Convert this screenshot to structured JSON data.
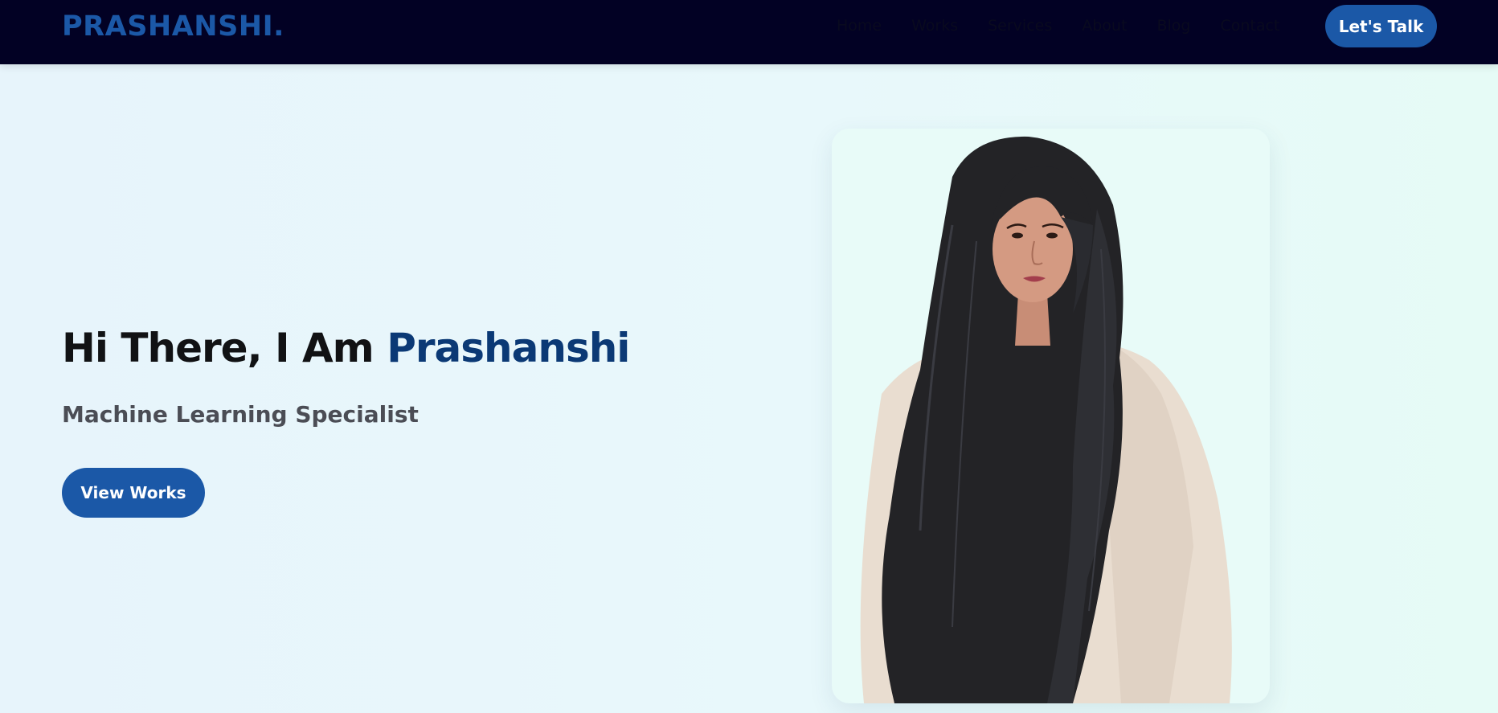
{
  "nav": {
    "logo": "PRASHANSHI.",
    "links": [
      "Home",
      "Works",
      "Services",
      "About",
      "Blog",
      "Contact"
    ],
    "cta": "Let's Talk"
  },
  "hero": {
    "greeting": "Hi There, I Am ",
    "name": "Prashanshi",
    "subtitle": "Machine Learning Specialist",
    "button": "View Works"
  },
  "colors": {
    "navbar": "#020124",
    "accent": "#1b58a7",
    "name": "#0b3975"
  }
}
